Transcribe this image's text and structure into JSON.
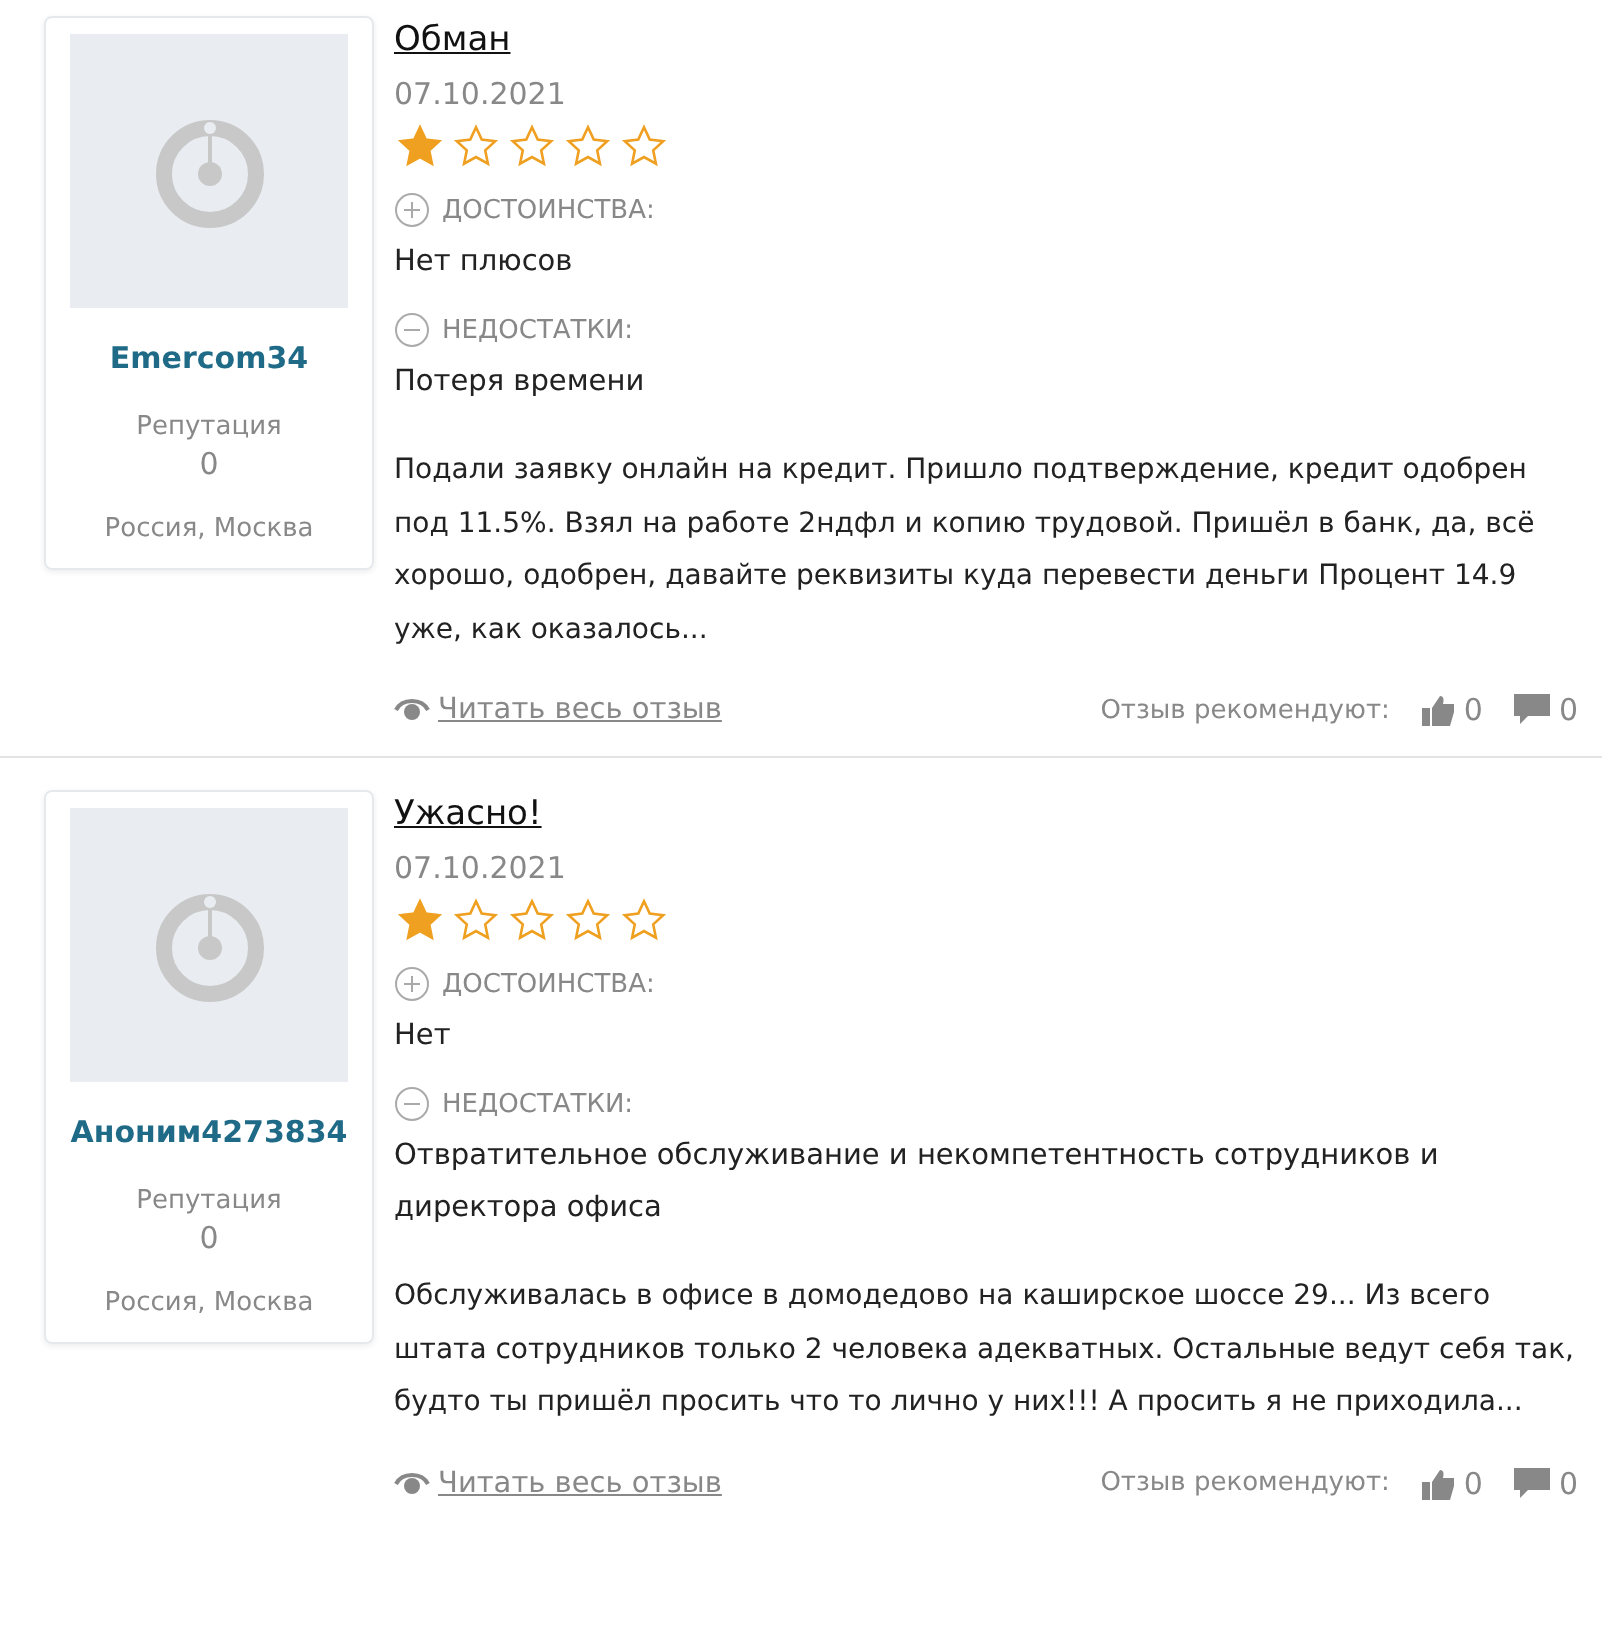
{
  "reviews": [
    {
      "author": {
        "name": "Emercom34",
        "reputation_label": "Репутация",
        "reputation": "0",
        "location": "Россия, Москва"
      },
      "title": "Обман",
      "date": "07.10.2021",
      "stars": 1,
      "pros_label": "ДОСТОИНСТВА:",
      "pros": "Нет плюсов",
      "cons_label": "НЕДОСТАТКИ:",
      "cons": "Потеря времени",
      "text": "Подали заявку онлайн на кредит. Пришло подтверждение, кредит одобрен под 11.5%. Взял на работе 2ндфл и копию трудовой. Пришёл в банк, да, всё хорошо, одобрен, давайте реквизиты куда перевести деньги Процент 14.9 уже, как оказалось...",
      "read_more": "Читать весь отзыв",
      "recommend_label": "Отзыв рекомендуют:",
      "likes": "0",
      "comments": "0"
    },
    {
      "author": {
        "name": "Аноним4273834",
        "reputation_label": "Репутация",
        "reputation": "0",
        "location": "Россия, Москва"
      },
      "title": "Ужасно!",
      "date": "07.10.2021",
      "stars": 1,
      "pros_label": "ДОСТОИНСТВА:",
      "pros": "Нет",
      "cons_label": "НЕДОСТАТКИ:",
      "cons": "Отвратительное обслуживание и некомпетентность сотрудников и директора офиса",
      "text": "Обслуживалась в офисе в домодедово на каширское шоссе 29... Из всего штата сотрудников только 2 человека адекватных. Остальные ведут себя так, будто ты пришёл просить что то лично у них!!! А просить я не приходила...",
      "read_more": "Читать весь отзыв",
      "recommend_label": "Отзыв рекомендуют:",
      "likes": "0",
      "comments": "0"
    }
  ]
}
